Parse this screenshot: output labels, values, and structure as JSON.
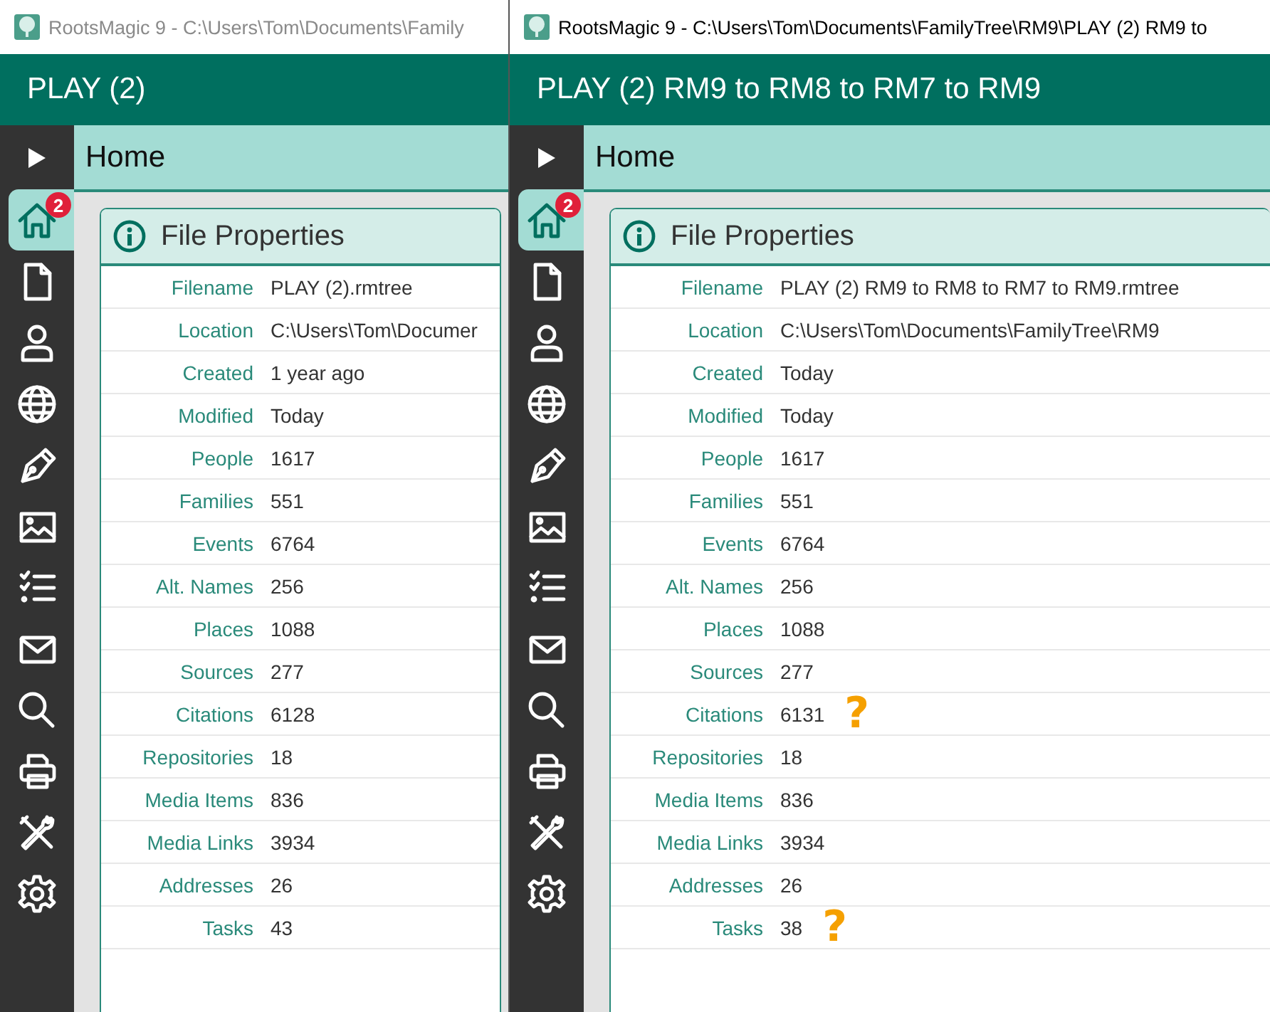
{
  "windows": [
    {
      "title": "RootsMagic 9 - C:\\Users\\Tom\\Documents\\Family",
      "active": false,
      "header": "PLAY (2)",
      "nav_label": "Home",
      "panel_title": "File Properties",
      "sidebar": [
        {
          "kind": "home",
          "selected": true,
          "badge": "2"
        },
        {
          "kind": "file",
          "selected": false
        },
        {
          "kind": "person",
          "selected": false
        },
        {
          "kind": "globe",
          "selected": false
        },
        {
          "kind": "pen",
          "selected": false
        },
        {
          "kind": "image",
          "selected": false
        },
        {
          "kind": "checklist",
          "selected": false
        },
        {
          "kind": "mail",
          "selected": false
        },
        {
          "kind": "search",
          "selected": false
        },
        {
          "kind": "printer",
          "selected": false
        },
        {
          "kind": "tools",
          "selected": false
        },
        {
          "kind": "gear",
          "selected": false
        }
      ],
      "rows": [
        {
          "label": "Filename",
          "value": "PLAY (2).rmtree"
        },
        {
          "label": "Location",
          "value": "C:\\Users\\Tom\\Documer"
        },
        {
          "label": "Created",
          "value": "1 year ago"
        },
        {
          "label": "Modified",
          "value": "Today"
        },
        {
          "label": "People",
          "value": "1617"
        },
        {
          "label": "Families",
          "value": "551"
        },
        {
          "label": "Events",
          "value": "6764"
        },
        {
          "label": "Alt. Names",
          "value": "256"
        },
        {
          "label": "Places",
          "value": "1088"
        },
        {
          "label": "Sources",
          "value": "277"
        },
        {
          "label": "Citations",
          "value": "6128"
        },
        {
          "label": "Repositories",
          "value": "18"
        },
        {
          "label": "Media Items",
          "value": "836"
        },
        {
          "label": "Media Links",
          "value": "3934"
        },
        {
          "label": "Addresses",
          "value": "26"
        },
        {
          "label": "Tasks",
          "value": "43"
        }
      ]
    },
    {
      "title": "RootsMagic 9 - C:\\Users\\Tom\\Documents\\FamilyTree\\RM9\\PLAY (2) RM9 to",
      "active": true,
      "header": "PLAY (2) RM9 to RM8 to RM7 to RM9",
      "nav_label": "Home",
      "panel_title": "File Properties",
      "sidebar": [
        {
          "kind": "home",
          "selected": true,
          "badge": "2"
        },
        {
          "kind": "file",
          "selected": false
        },
        {
          "kind": "person",
          "selected": false
        },
        {
          "kind": "globe",
          "selected": false
        },
        {
          "kind": "pen",
          "selected": false
        },
        {
          "kind": "image",
          "selected": false
        },
        {
          "kind": "checklist",
          "selected": false
        },
        {
          "kind": "mail",
          "selected": false
        },
        {
          "kind": "search",
          "selected": false
        },
        {
          "kind": "printer",
          "selected": false
        },
        {
          "kind": "tools",
          "selected": false
        },
        {
          "kind": "gear",
          "selected": false
        }
      ],
      "rows": [
        {
          "label": "Filename",
          "value": "PLAY (2) RM9 to RM8 to RM7 to RM9.rmtree"
        },
        {
          "label": "Location",
          "value": "C:\\Users\\Tom\\Documents\\FamilyTree\\RM9"
        },
        {
          "label": "Created",
          "value": "Today"
        },
        {
          "label": "Modified",
          "value": "Today"
        },
        {
          "label": "People",
          "value": "1617"
        },
        {
          "label": "Families",
          "value": "551"
        },
        {
          "label": "Events",
          "value": "6764"
        },
        {
          "label": "Alt. Names",
          "value": "256"
        },
        {
          "label": "Places",
          "value": "1088"
        },
        {
          "label": "Sources",
          "value": "277"
        },
        {
          "label": "Citations",
          "value": "6131",
          "note": "?"
        },
        {
          "label": "Repositories",
          "value": "18"
        },
        {
          "label": "Media Items",
          "value": "836"
        },
        {
          "label": "Media Links",
          "value": "3934"
        },
        {
          "label": "Addresses",
          "value": "26"
        },
        {
          "label": "Tasks",
          "value": "38",
          "note": "?"
        }
      ]
    }
  ]
}
